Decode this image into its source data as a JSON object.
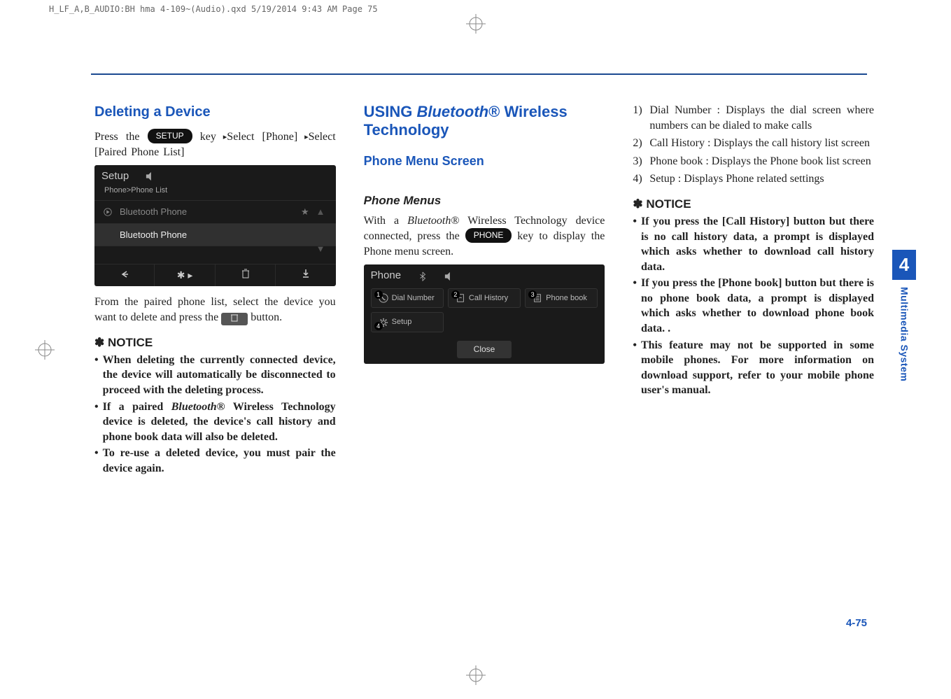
{
  "print_header": "H_LF_A,B_AUDIO:BH hma 4-109~(Audio).qxd  5/19/2014  9:43 AM  Page 75",
  "col1": {
    "h1": "Deleting a Device",
    "p1_a": "Press the ",
    "key_setup": "SETUP",
    "p1_b": " key",
    "p1_c": "Select [Phone]",
    "p1_d": "Select [Paired Phone List]",
    "screen1": {
      "title": "Setup",
      "crumb": "Phone>Phone List",
      "row1": "Bluetooth Phone",
      "row2": "Bluetooth Phone"
    },
    "p2_a": "From the paired phone list, select the device you want to delete and press the ",
    "p2_b": " button.",
    "notice": "NOTICE",
    "b1": "When deleting the currently connected device, the device will automatically be disconnected to proceed with the deleting process.",
    "b2_a": "If a paired ",
    "b2_bt": "Bluetooth",
    "b2_b": "®  Wireless Technology device is deleted, the device's call history and phone book data will also be deleted.",
    "b3": "To re-use a deleted device, you must pair the device again."
  },
  "col2": {
    "h_using_a": "USING ",
    "h_using_bt": "Bluetooth",
    "h_using_b": "®  Wireless Technology",
    "h_menu": "Phone Menu Screen",
    "h_sub": "Phone Menus",
    "p1_a": "With a ",
    "p1_bt": "Bluetooth",
    "p1_b": "®  Wireless Technology device connected, press the ",
    "key_phone": "PHONE",
    "p1_c": " key to display the Phone menu screen.",
    "screen2": {
      "title": "Phone",
      "cell1": "Dial Number",
      "cell2": "Call History",
      "cell3": "Phone book",
      "cell4": "Setup",
      "close": "Close"
    }
  },
  "col3": {
    "n1": "Dial Number : Displays the dial screen where numbers can be dialed to make calls",
    "n2": "Call History : Displays the call history list screen",
    "n3": "Phone book : Displays the Phone book list screen",
    "n4": "Setup : Displays Phone related settings",
    "notice": "NOTICE",
    "b1": "If you press the [Call History] button but there is no call history data, a prompt is displayed which asks whether to download call history data.",
    "b2": "If you press the [Phone book] button but there is no phone book data, a prompt is displayed which asks whether to download phone book data. .",
    "b3": "This feature may not be supported in some mobile phones. For more information on download support, refer to your mobile phone user's manual."
  },
  "side": {
    "num": "4",
    "label": "Multimedia System"
  },
  "page_num": "4-75"
}
